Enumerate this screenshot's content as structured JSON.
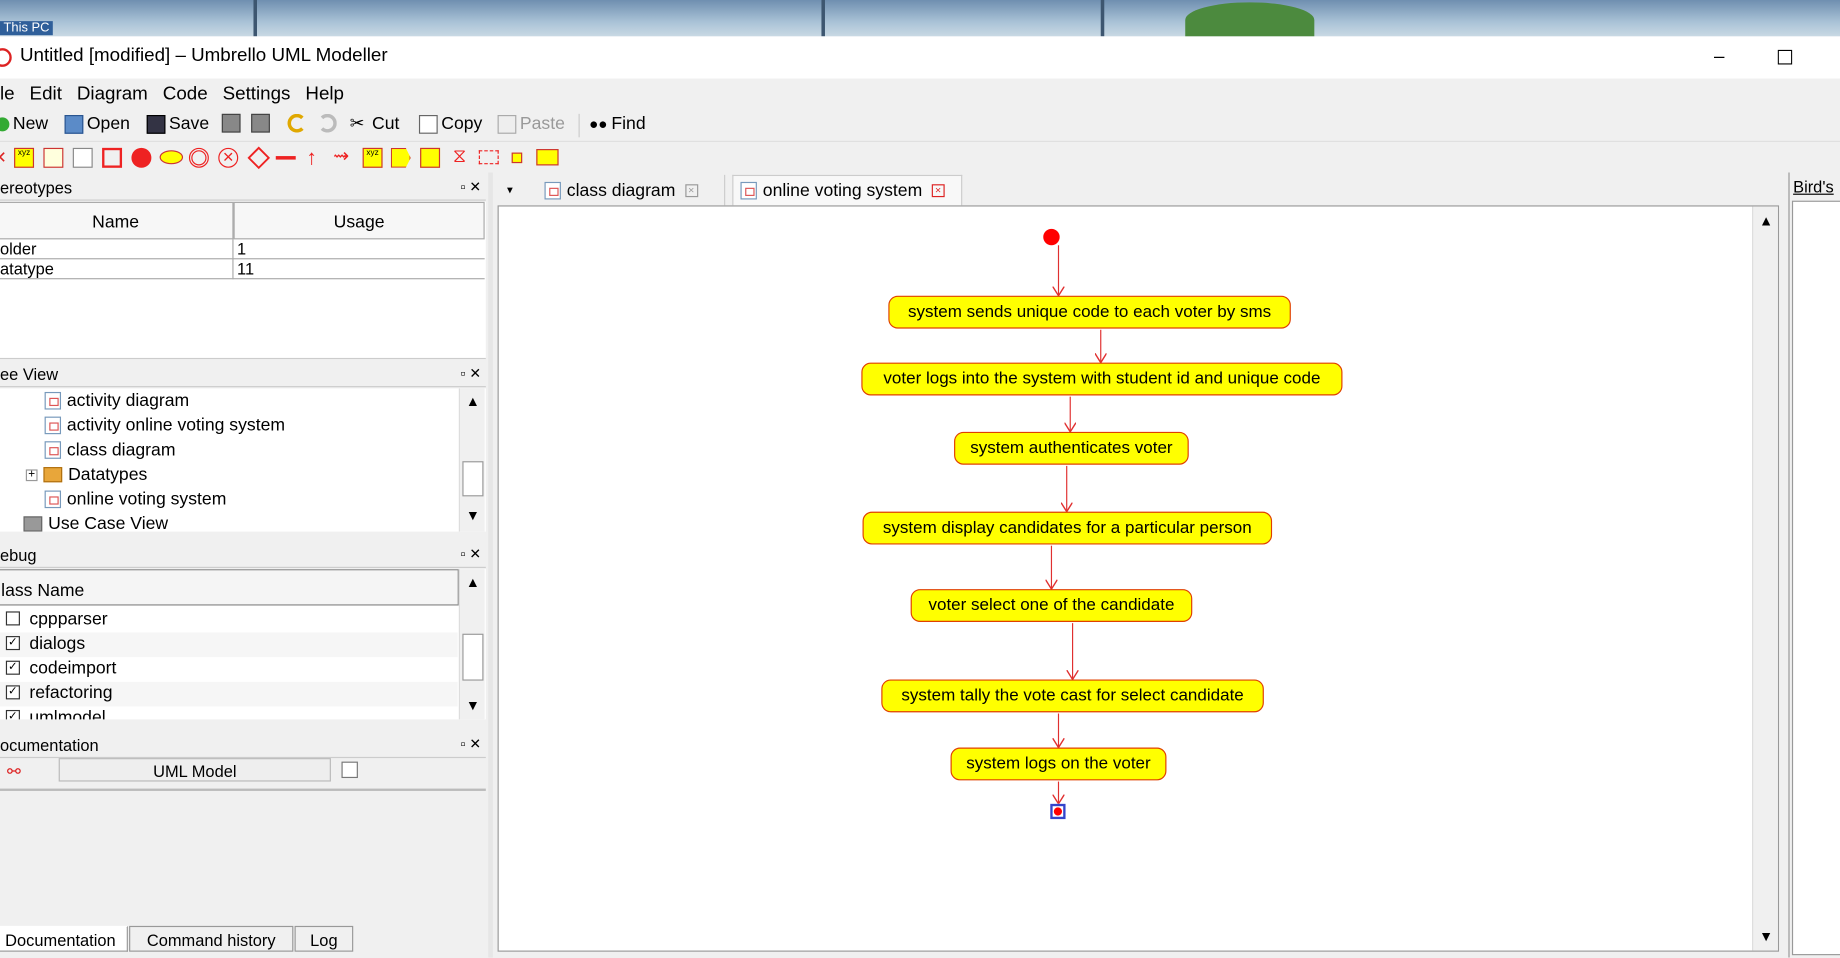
{
  "window": {
    "title": "Untitled [modified] – Umbrello UML Modeller",
    "minimize": "–",
    "maximize": "☐"
  },
  "desktop": {
    "icon_label": "This PC"
  },
  "menu": [
    "le",
    "Edit",
    "Diagram",
    "Code",
    "Settings",
    "Help"
  ],
  "toolbar": {
    "new": "New",
    "open": "Open",
    "save": "Save",
    "cut": "Cut",
    "copy": "Copy",
    "paste": "Paste",
    "find": "Find"
  },
  "stereotypes": {
    "title": "ereotypes",
    "columns": [
      "Name",
      "Usage"
    ],
    "rows": [
      {
        "name": "older",
        "usage": "1"
      },
      {
        "name": "atatype",
        "usage": "11"
      }
    ]
  },
  "treeview": {
    "title": "ee View",
    "items": [
      "activity diagram",
      "activity online voting  system",
      "class diagram",
      "Datatypes",
      "online voting system",
      "Use Case View"
    ]
  },
  "debug": {
    "title": "ebug",
    "column": "lass Name",
    "items": [
      {
        "label": "cppparser",
        "checked": false
      },
      {
        "label": "dialogs",
        "checked": true
      },
      {
        "label": "codeimport",
        "checked": true
      },
      {
        "label": "refactoring",
        "checked": true
      },
      {
        "label": "umlmodel",
        "checked": true
      }
    ]
  },
  "documentation": {
    "title": "ocumentation",
    "model_label": "UML Model"
  },
  "bottom_tabs": [
    "Documentation",
    "Command history",
    "Log"
  ],
  "diagram_tabs": [
    {
      "label": "class diagram",
      "active": false
    },
    {
      "label": "online voting system",
      "active": true
    }
  ],
  "birds_eye": {
    "title": "Bird's e"
  },
  "activities": [
    "system sends unique code to each voter by sms",
    "voter logs into the system with student id and unique code",
    "system authenticates voter",
    "system display candidates for a particular person",
    "voter select one of the candidate",
    "system tally the vote cast for select candidate",
    "system logs on the voter"
  ],
  "colors": {
    "activity_fill": "#ffff00",
    "activity_border": "#e04000",
    "arrow": "#e03030",
    "initial_node": "#ff0000"
  }
}
